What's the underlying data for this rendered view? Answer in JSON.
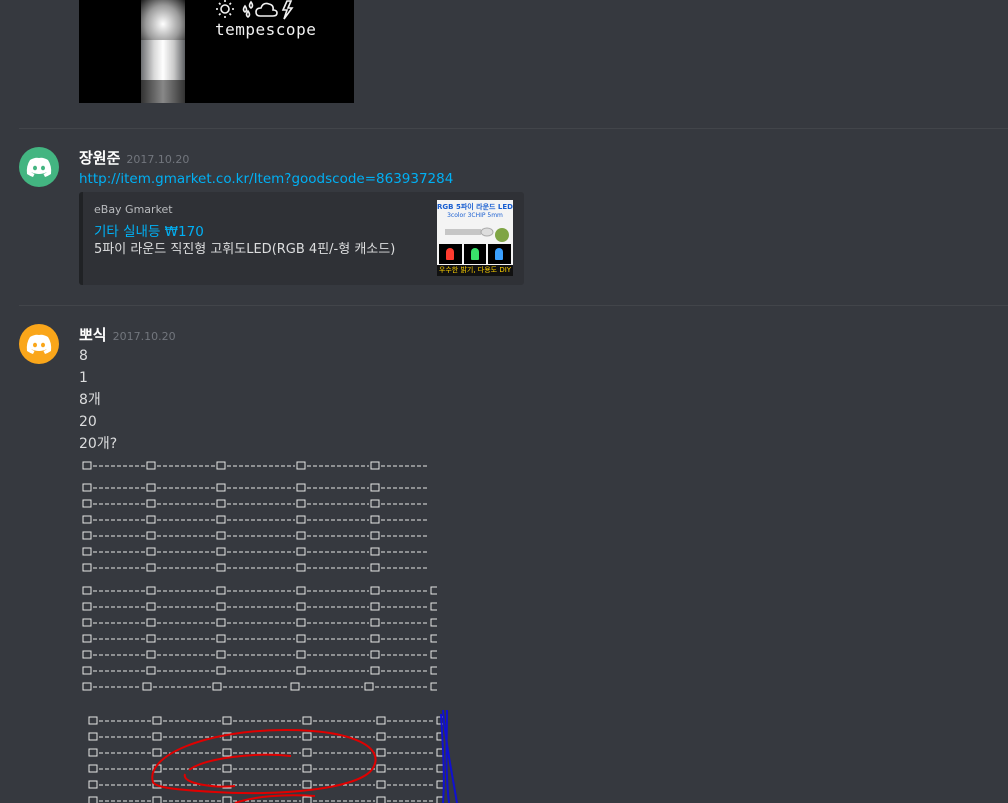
{
  "attachment": {
    "brand_text": "tempescope",
    "weather_icons": [
      "sun-icon",
      "rain-drops-icon",
      "cloud-icon",
      "lightning-icon"
    ]
  },
  "messages": [
    {
      "username": "장원준",
      "timestamp": "2017.10.20",
      "avatar_color": "#43b581",
      "link": "http://item.gmarket.co.kr/Item?goodscode=863937284",
      "embed": {
        "provider": "eBay Gmarket",
        "title": "기타 실내등 ₩170",
        "description": "5파이 라운드 직진형 고휘도LED(RGB 4핀/-형 캐소드)",
        "thumbnail": {
          "heading": "RGB 5파이 라운드 LED",
          "subheading": "3color 3CHIP 5mm",
          "footer": "우수한 밝기, 다용도 DIY"
        }
      }
    },
    {
      "username": "뽀식",
      "timestamp": "2017.10.20",
      "avatar_color": "#faa61a",
      "lines": [
        "8",
        "1",
        "8개",
        "20",
        "20개?"
      ]
    }
  ],
  "colors": {
    "background": "#36393f",
    "link": "#00b0f4",
    "embed_bg": "#2f3136",
    "annotation_red": "#e00000",
    "annotation_blue": "#1010d0"
  }
}
